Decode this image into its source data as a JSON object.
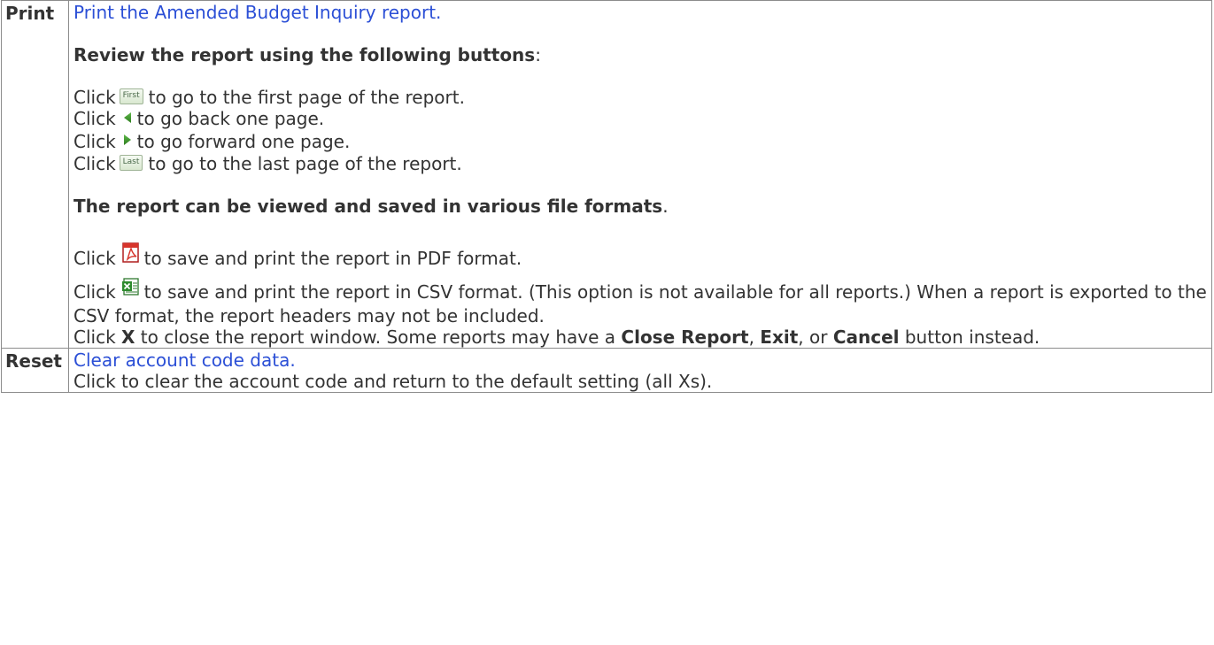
{
  "rows": [
    {
      "label": "Print",
      "link_text": "Print the Amended Budget Inquiry report.",
      "review_heading": "Review the report using the following buttons",
      "review_heading_suffix": ":",
      "buttons": [
        {
          "prefix": "Click",
          "icon": "first-button-icon",
          "icon_text": "First",
          "suffix": "to go to the first page of the report."
        },
        {
          "prefix": "Click",
          "icon": "back-arrow-icon",
          "suffix": "to go back one page."
        },
        {
          "prefix": "Click",
          "icon": "forward-arrow-icon",
          "suffix": "to go forward one page."
        },
        {
          "prefix": "Click",
          "icon": "last-button-icon",
          "icon_text": "Last",
          "suffix": "to go to the last page of the report."
        }
      ],
      "formats_heading": "The report can be viewed and saved in various file formats",
      "formats_heading_suffix": ".",
      "pdf_line": {
        "prefix": "Click",
        "icon": "pdf-icon",
        "suffix": "to save and print the report in PDF format."
      },
      "csv_line": {
        "prefix": "Click",
        "icon": "csv-icon",
        "suffix": "to save and print the report in CSV format. (This option is not available for all reports.) When a report is exported to the CSV format, the report headers may not be included."
      },
      "close_line": {
        "prefix": "Click",
        "x_label": "X",
        "middle": "to close the report window. Some reports may have a",
        "close_report": "Close Report",
        "comma1": ",",
        "exit": "Exit",
        "or_text": ", or",
        "cancel": "Cancel",
        "end": "button instead."
      }
    },
    {
      "label": "Reset",
      "link_text": "Clear account code data.",
      "description": "Click to clear the account code and return to the default setting (all Xs)."
    }
  ],
  "colors": {
    "link": "#2b4fd6",
    "text": "#333333",
    "border": "#8c8c8c"
  }
}
